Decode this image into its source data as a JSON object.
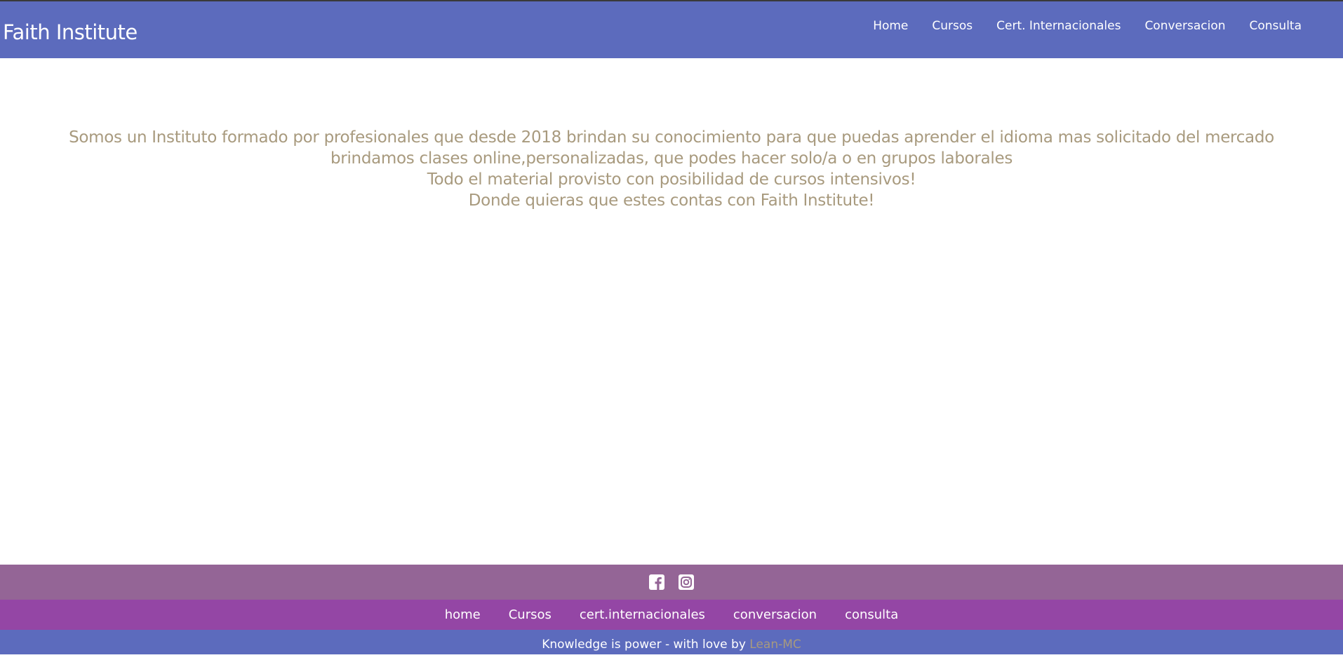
{
  "navbar": {
    "brand": "Faith Institute",
    "links": [
      {
        "label": "Home"
      },
      {
        "label": "Cursos"
      },
      {
        "label": "Cert. Internacionales"
      },
      {
        "label": "Conversacion"
      },
      {
        "label": "Consulta"
      }
    ]
  },
  "intro": {
    "lines": [
      "Somos un Instituto formado por profesionales que desde 2018 brindan su conocimiento para que puedas aprender el idioma mas solicitado del mercado",
      "brindamos clases online,personalizadas, que podes hacer solo/a o en grupos laborales",
      "Todo el material provisto con posibilidad de cursos intensivos!",
      "Donde quieras que estes contas con Faith Institute!"
    ]
  },
  "footer": {
    "social": [
      {
        "icon": "facebook-icon"
      },
      {
        "icon": "instagram-icon"
      }
    ],
    "links": [
      {
        "label": "home"
      },
      {
        "label": "Cursos"
      },
      {
        "label": "cert.internacionales"
      },
      {
        "label": "conversacion"
      },
      {
        "label": "consulta"
      }
    ],
    "credit_text": "Knowledge is power - with love by ",
    "credit_author": "Lean-MC"
  },
  "colors": {
    "navbar": "#5c6bbd",
    "intro_text": "#a89a7e",
    "footer_social": "#946596",
    "footer_nav": "#9446a5",
    "footer_credit": "#5c6bbd"
  }
}
